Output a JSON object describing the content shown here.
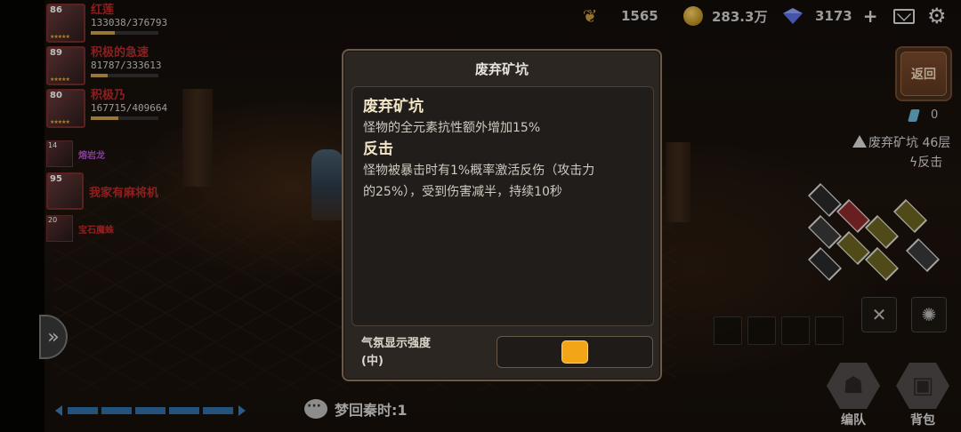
{
  "resources": {
    "wheat": "1565",
    "gold": "283.3万",
    "gems": "3173",
    "add_label": "+",
    "icons": [
      "wheat-icon",
      "coin-icon",
      "gem-icon",
      "plus-icon",
      "mail-icon",
      "gear-icon"
    ]
  },
  "party": [
    {
      "level": "86",
      "name": "红莲",
      "hp": "133038/376793",
      "hp_fraction": 0.35
    },
    {
      "level": "89",
      "name": "积极的急速",
      "hp": "81787/333613",
      "hp_fraction": 0.25
    },
    {
      "level": "80",
      "name": "积极乃",
      "hp": "167715/409664",
      "hp_fraction": 0.41
    }
  ],
  "small_party": [
    {
      "level": "14",
      "name": "熔岩龙",
      "color": "#b24fcf"
    },
    {
      "level": "95",
      "name": "我家有麻将机",
      "color": "#c0282a"
    },
    {
      "level": "20",
      "name": "宝石魔蛛",
      "color": "#c0282a"
    }
  ],
  "dialog": {
    "title": "废弃矿坑",
    "sections": [
      {
        "heading": "废弃矿坑",
        "text": "怪物的全元素抗性额外增加15%"
      },
      {
        "heading": "反击",
        "text_line1": "怪物被暴击时有1%概率激活反伤（攻击力",
        "text_line2": "的25%），受到伤害减半，持续10秒"
      }
    ],
    "ambience_label_line1": "气氛显示强度",
    "ambience_label_line2": "(中)",
    "ambience_level": 0.5
  },
  "right_panel": {
    "back_label": "返回",
    "key_count": "0",
    "floor_text": "废弃矿坑 46层",
    "mutator_text": "反击"
  },
  "bottom": {
    "dream_text": "梦回秦时:1",
    "team_label": "编队",
    "bag_label": "背包"
  },
  "colors": {
    "accent": "#f2a516",
    "party_name": "#c0282a",
    "dialog_bg": "#2b2622"
  }
}
